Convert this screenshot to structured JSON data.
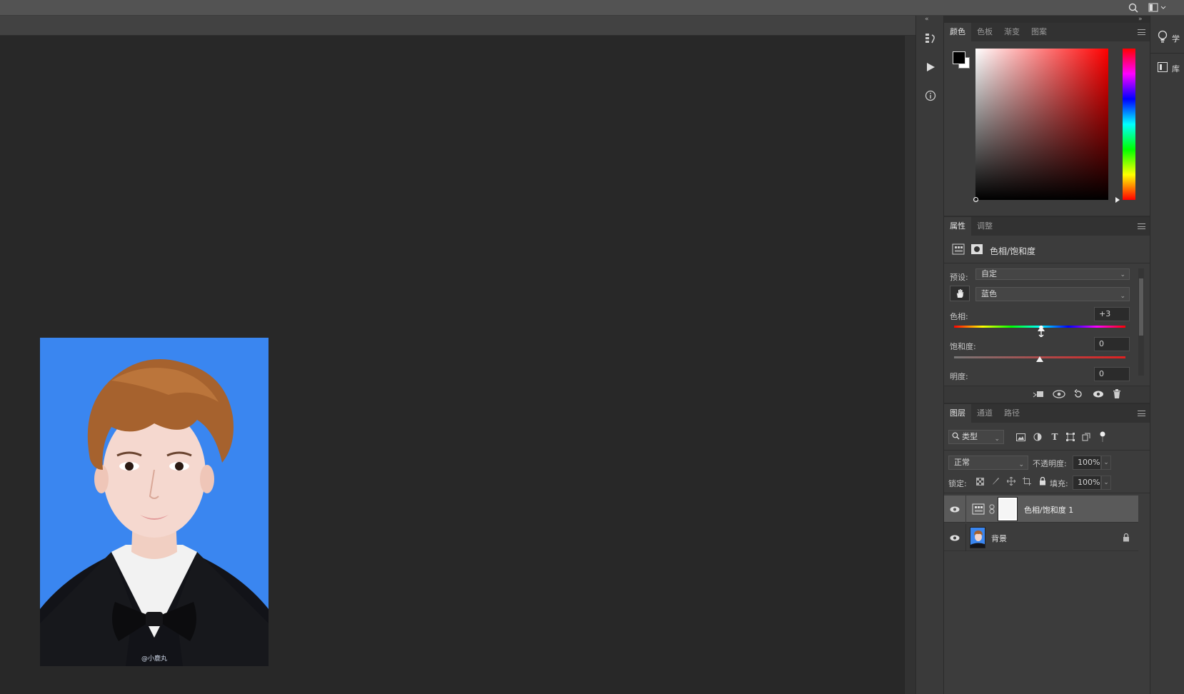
{
  "color_panel": {
    "tabs": [
      "颜色",
      "色板",
      "渐变",
      "图案"
    ],
    "active_tab": "颜色",
    "foreground": "#000000",
    "background": "#ffffff",
    "field_hue_color": "#ff0000"
  },
  "properties_panel": {
    "tabs": [
      "属性",
      "调整"
    ],
    "active_tab": "属性",
    "adjustment_title": "色相/饱和度",
    "preset_label": "预设:",
    "preset_value": "自定",
    "channel_value": "蓝色",
    "hue_label": "色相:",
    "hue_value": "+3",
    "saturation_label": "饱和度:",
    "saturation_value": "0",
    "lightness_label": "明度:",
    "lightness_value": "0"
  },
  "layers_panel": {
    "tabs": [
      "图层",
      "通道",
      "路径"
    ],
    "active_tab": "图层",
    "filter_kind": "类型",
    "blend_mode": "正常",
    "opacity_label": "不透明度:",
    "opacity_value": "100%",
    "lock_label": "锁定:",
    "fill_label": "填充:",
    "fill_value": "100%",
    "layers": [
      {
        "name": "色相/饱和度 1",
        "selected": true,
        "type": "adjustment"
      },
      {
        "name": "背景",
        "selected": false,
        "type": "image",
        "locked": true
      }
    ]
  },
  "far_strip": {
    "learn_label": "学",
    "library_label": "库"
  },
  "document": {
    "background_color": "#3a86f0",
    "watermark": "@小鹿丸"
  }
}
